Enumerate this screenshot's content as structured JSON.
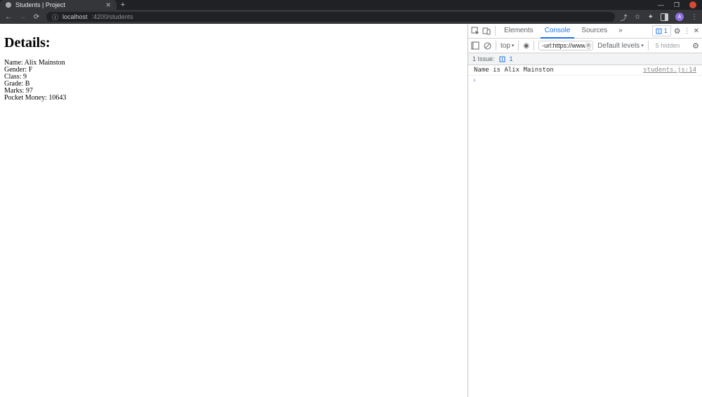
{
  "browser": {
    "tab_title": "Students | Project",
    "new_tab_glyph": "+",
    "win_min": "—",
    "win_max": "❐",
    "back": "←",
    "forward": "→",
    "reload": "⟳",
    "info": "ⓘ",
    "url_host": "localhost",
    "url_port_path": ":4200/students",
    "share": "⤴",
    "star": "☆",
    "ext": "✦",
    "menu": "⋮",
    "avatar": "A"
  },
  "page": {
    "heading": "Details:",
    "rows": {
      "name": "Name: Alix Mainston",
      "gender": "Gender: F",
      "class": "Class: 9",
      "grade": "Grade: B",
      "marks": "Marks: 97",
      "pocket": "Pocket Money: 10643"
    }
  },
  "devtools": {
    "tab_elements": "Elements",
    "tab_console": "Console",
    "tab_sources": "Sources",
    "more": "»",
    "issue_count": "1",
    "gear": "⚙",
    "close": "✕",
    "kebab": "⋮",
    "context_label": "top",
    "dropdown": "▾",
    "eye": "◉",
    "filter_value": "-url:https://www.ge",
    "levels_label": "Default levels",
    "hidden_label": "5 hidden",
    "issue_row_label": "1 Issue:",
    "issue_row_count": "1",
    "log_message": "Name is Alix Mainston",
    "log_source": "students.js:14",
    "prompt": "›"
  }
}
